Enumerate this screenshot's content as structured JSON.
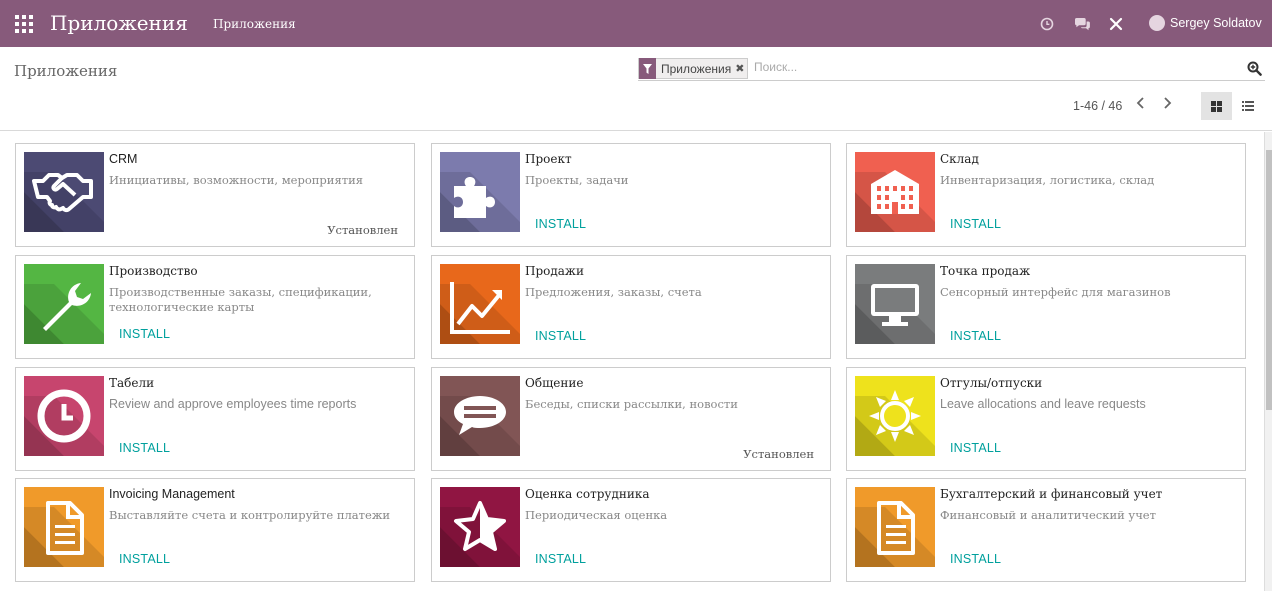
{
  "navbar": {
    "brand": "Приложения",
    "menu_item": "Приложения",
    "user_name": "Sergey Soldatov",
    "icons": [
      "apps-grid-icon",
      "clock-icon",
      "chat-icon",
      "debug-icon"
    ]
  },
  "control_panel": {
    "breadcrumb": "Приложения",
    "facet_label": "Приложения",
    "facet_close": "✖",
    "search_placeholder": "Поиск...",
    "pager": "1-46 / 46",
    "pager_prev": "‹",
    "pager_next": "›"
  },
  "colors": {
    "navbar": "#875a7b",
    "install": "#00a09d"
  },
  "apps": [
    {
      "title": "CRM",
      "desc": "Инициативы, возможности, мероприятия",
      "status": "Установлен",
      "action": "",
      "color": "#4c4a73",
      "icon": "handshake-icon"
    },
    {
      "title": "Проект",
      "desc": "Проекты, задачи",
      "status": "",
      "action": "INSTALL",
      "color": "#7c7bad",
      "icon": "puzzle-icon"
    },
    {
      "title": "Склад",
      "desc": "Инвентаризация, логистика, склад",
      "status": "",
      "action": "INSTALL",
      "color": "#f06050",
      "icon": "building-icon"
    },
    {
      "title": "Производство",
      "desc": "Производственные заказы, спецификации, технологические карты",
      "status": "",
      "action": "INSTALL",
      "color": "#54b643",
      "icon": "wrench-icon"
    },
    {
      "title": "Продажи",
      "desc": "Предложения, заказы, счета",
      "status": "",
      "action": "INSTALL",
      "color": "#e8681b",
      "icon": "chart-line-icon"
    },
    {
      "title": "Точка продаж",
      "desc": "Сенсорный интерфейс для магазинов",
      "status": "",
      "action": "INSTALL",
      "color": "#7a7c7d",
      "icon": "monitor-icon"
    },
    {
      "title": "Табели",
      "desc": "Review and approve employees time reports",
      "status": "",
      "action": "INSTALL",
      "color": "#c7456e",
      "icon": "clock-face-icon"
    },
    {
      "title": "Общение",
      "desc": "Беседы, списки рассылки, новости",
      "status": "Установлен",
      "action": "",
      "color": "#815555",
      "icon": "speech-bubble-icon"
    },
    {
      "title": "Отгулы/отпуски",
      "desc": "Leave allocations and leave requests",
      "status": "",
      "action": "INSTALL",
      "color": "#eee21c",
      "icon": "sun-icon"
    },
    {
      "title": "Invoicing Management",
      "desc": "Выставляйте счета и контролируйте платежи",
      "status": "",
      "action": "INSTALL",
      "color": "#f09a2a",
      "icon": "document-icon"
    },
    {
      "title": "Оценка сотрудника",
      "desc": "Периодическая оценка",
      "status": "",
      "action": "INSTALL",
      "color": "#901542",
      "icon": "star-icon"
    },
    {
      "title": "Бухгалтерский и финансовый учет",
      "desc": "Финансовый и аналитический учет",
      "status": "",
      "action": "INSTALL",
      "color": "#f09a2a",
      "icon": "document-icon"
    }
  ]
}
